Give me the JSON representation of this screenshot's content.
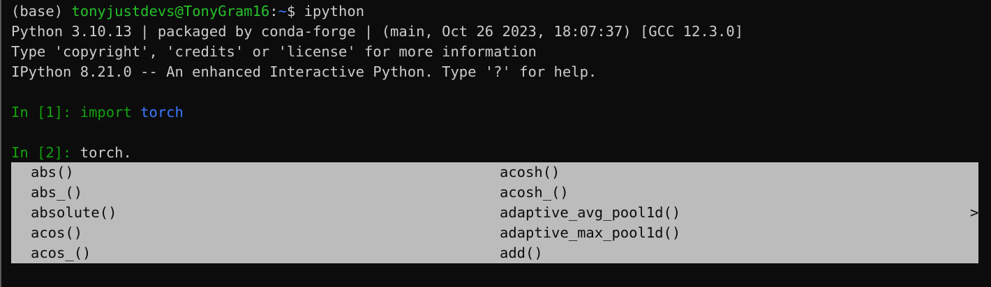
{
  "prompt": {
    "env": "(base) ",
    "user_host": "tonyjustdevs@TonyGram16",
    "sep": ":",
    "path": "~",
    "dollar": "$ ",
    "command": "ipython"
  },
  "banner": [
    "Python 3.10.13 | packaged by conda-forge | (main, Oct 26 2023, 18:07:37) [GCC 12.3.0]",
    "Type 'copyright', 'credits' or 'license' for more information",
    "IPython 8.21.0 -- An enhanced Interactive Python. Type '?' for help."
  ],
  "cells": [
    {
      "prompt": "In [1]: ",
      "keyword": "import",
      "space": " ",
      "module": "torch"
    },
    {
      "prompt": "In [2]: ",
      "input": "torch."
    }
  ],
  "completions": {
    "col1": [
      "abs()",
      "abs_()",
      "absolute()",
      "acos()",
      "acos_()"
    ],
    "col2": [
      "acosh()",
      "acosh_()",
      "adaptive_avg_pool1d()",
      "adaptive_max_pool1d()",
      "add()"
    ],
    "more_indicator": ">"
  },
  "colors": {
    "background": "#0c0c0c",
    "text": "#cccccc",
    "prompt_green": "#13a10e",
    "path_blue": "#3b78ff",
    "completion_bg": "#bcbcbc"
  }
}
